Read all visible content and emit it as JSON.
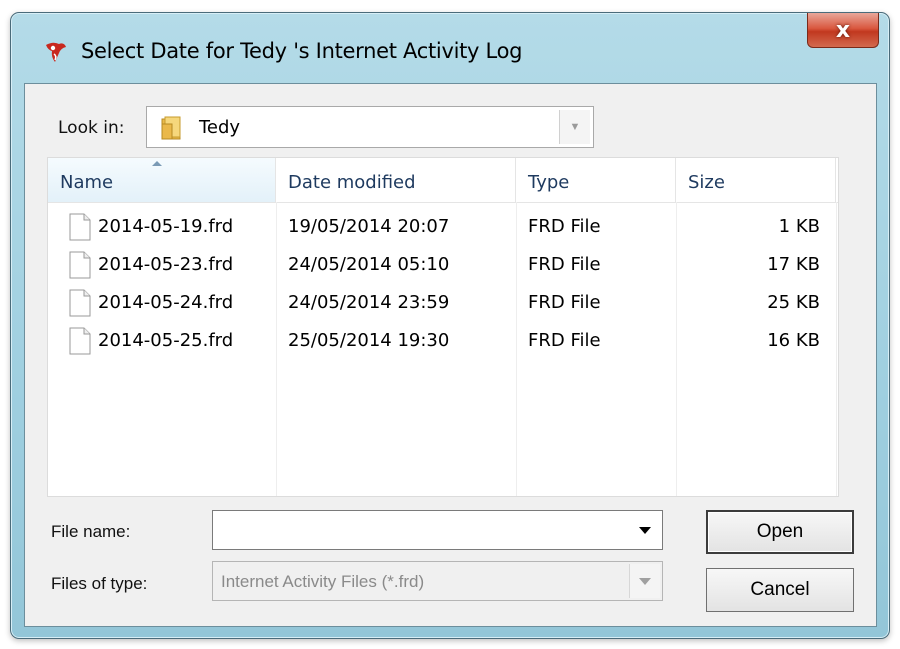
{
  "window": {
    "title": "Select Date for Tedy 's Internet Activity Log",
    "close_label": "x"
  },
  "look_in": {
    "label": "Look in:",
    "value": "Tedy"
  },
  "columns": [
    "Name",
    "Date modified",
    "Type",
    "Size"
  ],
  "files": [
    {
      "name": "2014-05-19.frd",
      "date": "19/05/2014 20:07",
      "type": "FRD File",
      "size": "1 KB"
    },
    {
      "name": "2014-05-23.frd",
      "date": "24/05/2014 05:10",
      "type": "FRD File",
      "size": "17 KB"
    },
    {
      "name": "2014-05-24.frd",
      "date": "24/05/2014 23:59",
      "type": "FRD File",
      "size": "25 KB"
    },
    {
      "name": "2014-05-25.frd",
      "date": "25/05/2014 19:30",
      "type": "FRD File",
      "size": "16 KB"
    }
  ],
  "file_name": {
    "label": "File name:",
    "value": ""
  },
  "file_type": {
    "label": "Files of type:",
    "value": "Internet Activity Files (*.frd)"
  },
  "buttons": {
    "open": "Open",
    "cancel": "Cancel"
  },
  "icons": {
    "app": "app-logo-icon",
    "folder": "folder-icon",
    "file": "file-icon",
    "close": "close-icon",
    "dropdown": "chevron-down-icon"
  },
  "colors": {
    "frame": "#9fcfe0",
    "close": "#d9583f",
    "header_text": "#1e3a5f"
  }
}
